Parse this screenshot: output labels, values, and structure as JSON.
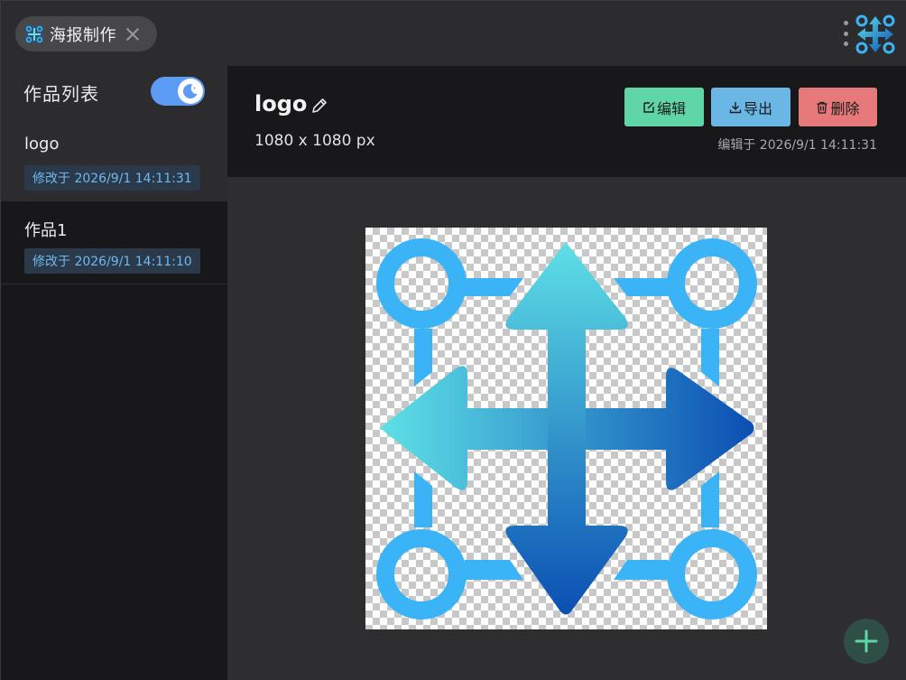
{
  "tab": {
    "label": "海报制作",
    "icon": "app-grid-icon"
  },
  "sidebar": {
    "title": "作品列表",
    "theme_toggle": {
      "state": "on",
      "icon": "moon-icon"
    },
    "items": [
      {
        "name": "logo",
        "modified": "修改于 2026/9/1 14:11:31",
        "active": true
      },
      {
        "name": "作品1",
        "modified": "修改于 2026/9/1 14:11:10",
        "active": false
      }
    ]
  },
  "main": {
    "title": "logo",
    "size": "1080 x 1080 px",
    "buttons": {
      "edit": "编辑",
      "export": "导出",
      "delete": "删除"
    },
    "edited_at": "编辑于 2026/9/1 14:11:31"
  },
  "colors": {
    "edit": "#5fd5a8",
    "export": "#6ab7e6",
    "delete": "#e67a7a",
    "badge_text": "#6fb8ee",
    "toggle": "#5d9cf5",
    "logo_blue": "#3ab4f7",
    "arrow_light": "#5ee0e6",
    "arrow_dark": "#0b4fb3"
  }
}
